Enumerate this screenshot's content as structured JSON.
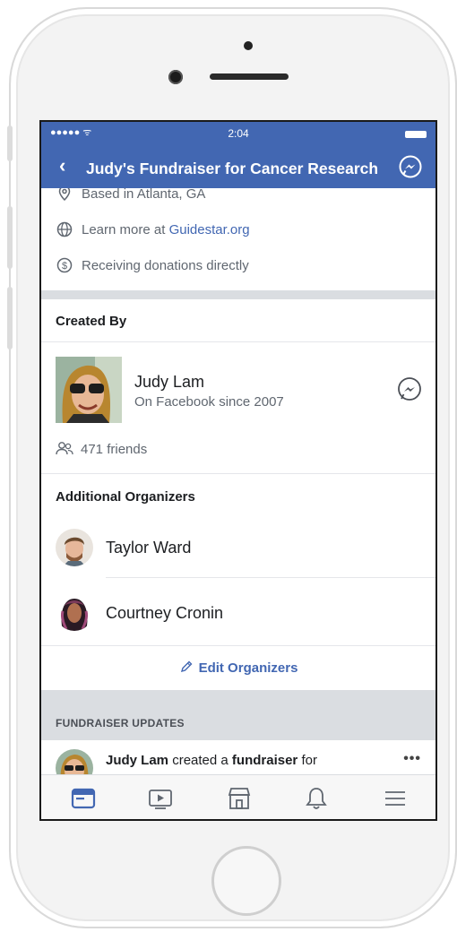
{
  "status_bar": {
    "signal": "●●●●● ᯤ",
    "time": "2:04"
  },
  "nav": {
    "back_icon": "chevron-left-icon",
    "title": "Judy's Fundraiser for Cancer Research",
    "messenger_icon": "messenger-icon"
  },
  "info": {
    "location": "Based in Atlanta, GA",
    "learn_more_prefix": "Learn more at ",
    "learn_more_link": "Guidestar.org",
    "donations": "Receiving donations directly"
  },
  "created_by": {
    "title": "Created By",
    "name": "Judy Lam",
    "subtitle": "On Facebook since 2007",
    "friends": "471 friends"
  },
  "organizers": {
    "title": "Additional Organizers",
    "items": [
      {
        "name": "Taylor Ward"
      },
      {
        "name": "Courtney Cronin"
      }
    ],
    "edit_label": "Edit Organizers"
  },
  "updates": {
    "title": "FUNDRAISER UPDATES",
    "author": "Judy Lam",
    "middle": " created a ",
    "bold2": "fundraiser",
    "rest": " for",
    "more": "•••"
  },
  "tabbar": {
    "items": [
      "news-feed-icon",
      "watch-icon",
      "marketplace-icon",
      "notifications-icon",
      "menu-icon"
    ]
  },
  "colors": {
    "brand": "#4267b2",
    "divider": "#dadde1",
    "secondary_text": "#606770"
  }
}
